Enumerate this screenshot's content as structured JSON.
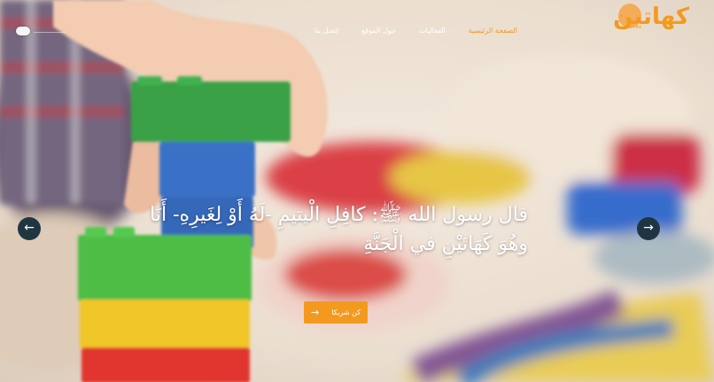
{
  "brand": {
    "name": "كهاتين",
    "accent": "#f39a1e",
    "dark_button": "#1f3642"
  },
  "nav": {
    "items": [
      {
        "label": "الصفحة الرئيسية",
        "active": true
      },
      {
        "label": "الفعاليات",
        "active": false
      },
      {
        "label": "حول الموقع",
        "active": false
      },
      {
        "label": "إتصل بنا",
        "active": false
      }
    ]
  },
  "menu": {
    "icon": "menu-icon"
  },
  "slider": {
    "prev_icon": "←",
    "next_icon": "→",
    "quote": "قال رسول الله ﷺ: كافِلِ الْيتيمِ -لَهُ أَوْ لِغَيرِهِ- أَنَا وهُوَ كَهَاتَيْنِ في الْجَنَّةِ",
    "cta_label": "كن شريكا",
    "cta_icon": "→"
  }
}
